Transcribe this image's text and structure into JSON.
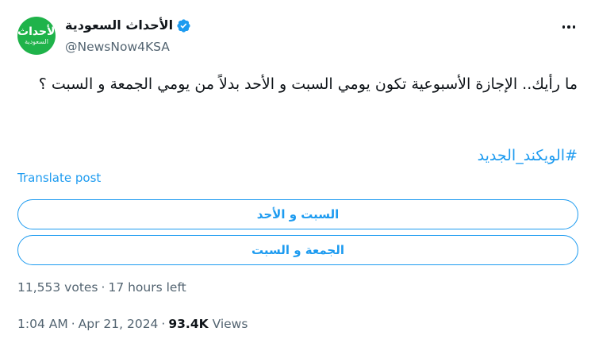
{
  "author": {
    "display_name": "الأحداث السعودية",
    "handle": "@NewsNow4KSA",
    "avatar_text_main": "الأحداث",
    "avatar_text_sub": "السعودية"
  },
  "tweet": {
    "text": "ما رأيك.. الإجازة الأسبوعية تكون يومي السبت و الأحد بدلاً من يومي الجمعة و السبت ؟",
    "hashtag": "#الويكند_الجديد",
    "translate_label": "Translate post"
  },
  "poll": {
    "options": [
      "السبت و الأحد",
      "الجمعة و السبت"
    ],
    "votes": "11,553 votes",
    "time_left": "17 hours left",
    "separator": "·"
  },
  "meta": {
    "time": "1:04 AM",
    "date": "Apr 21, 2024",
    "views_count": "93.4K",
    "views_label": "Views",
    "separator": "·"
  },
  "colors": {
    "accent": "#1d9bf0",
    "avatar_bg": "#1fb34a",
    "muted": "#536471",
    "text": "#0f1419"
  },
  "icons": {
    "verified": "verified-badge-icon",
    "more": "more-horizontal-icon"
  }
}
